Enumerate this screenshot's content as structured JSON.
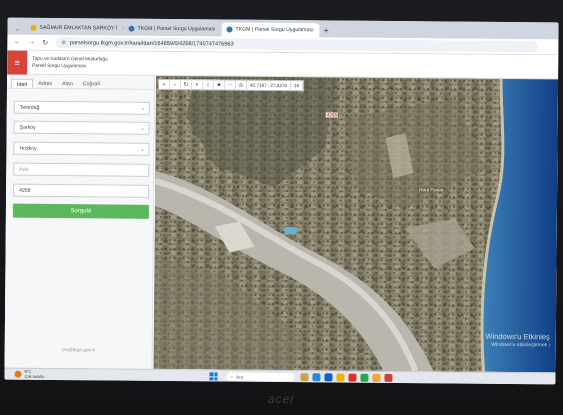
{
  "browser": {
    "tabs": [
      {
        "title": "SAĞMUR EMLAKTAN ŞARKÖY İ",
        "active": false
      },
      {
        "title": "TKGM | Parsel Sorgu Uygulaması",
        "active": false
      },
      {
        "title": "TKGM | Parsel Sorgu Uygulaması",
        "active": true
      }
    ],
    "url": "parselsorgu.tkgm.gov.tr/#ara/idari/164859/0/4268/1740747476963",
    "new_tab": "+"
  },
  "app": {
    "org_line1": "Tapu ve Kadastro Genel Müdürlüğü",
    "org_line2": "Parsel Sorgu Uygulaması",
    "sidebar_tabs": [
      "İdari",
      "Adres",
      "Alan",
      "Coğrafi"
    ],
    "province": "Tekirdağ",
    "district": "Şarköy",
    "neighborhood": "Hoşköy",
    "ada_placeholder": "Ada",
    "parsel_value": "4268",
    "query_button": "Sorgula",
    "support_email": "pls@tkgm.gov.tr"
  },
  "map": {
    "toolbar": [
      "+",
      "−",
      "↻",
      "⌖",
      "i",
      "★",
      "⋯",
      "⎙"
    ],
    "coords": "40.7197 : 27.3270",
    "zoom": "16",
    "parcel_label": "4268",
    "place_label": "Hora Fenerı",
    "watermark_title": "Windows'u Etkinleş",
    "watermark_sub": "Windows'u etkinleştirmek i"
  },
  "taskbar": {
    "temp": "8°C",
    "weather": "Çok bulutlu",
    "search": "Ara"
  },
  "colors": {
    "menu_red": "#d9443a",
    "button_green": "#5cb85c",
    "sea_blue": "#1d66b3"
  }
}
